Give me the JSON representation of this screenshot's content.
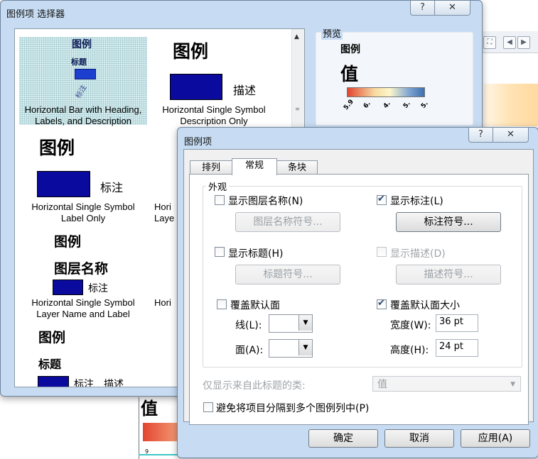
{
  "background": {
    "legend_value": "值",
    "tick": "9"
  },
  "selector": {
    "title": "图例项 选择器",
    "help": "?",
    "close": "✕",
    "items": [
      {
        "heading": "图例",
        "sub": "标题",
        "ticks": "标注",
        "caption": "Horizontal Bar with Heading, Labels, and Description"
      },
      {
        "heading": "图例",
        "desc": "描述",
        "caption": "Horizontal Single Symbol Description Only"
      },
      {
        "heading": "图例",
        "label": "标注",
        "caption": "Horizontal Single Symbol Label Only"
      },
      {
        "caption_partial": "Hori Laye"
      },
      {
        "heading": "图例",
        "layer": "图层名称",
        "label": "标注",
        "caption": "Horizontal Single Symbol Layer Name and Label"
      },
      {
        "caption_partial": "Hori"
      },
      {
        "heading": "图例",
        "sub": "标题",
        "label": "标注",
        "desc": "描述"
      }
    ],
    "preview": {
      "group_title": "预览",
      "legend_title": "图例",
      "value_title": "值",
      "ticks": [
        "5.9",
        "6.",
        "4.",
        "5.",
        "5."
      ]
    }
  },
  "dialog": {
    "title": "图例项",
    "help": "?",
    "close": "✕",
    "tabs": [
      "排列",
      "常规",
      "条块"
    ],
    "active_tab": "常规",
    "group_title": "外观",
    "show_layer_name": {
      "label": "显示图层名称(N)",
      "checked": false
    },
    "layer_symbol_btn": "图层名称符号...",
    "show_label": {
      "label": "显示标注(L)",
      "checked": true
    },
    "label_symbol_btn": "标注符号...",
    "show_heading": {
      "label": "显示标题(H)",
      "checked": false
    },
    "heading_symbol_btn": "标题符号...",
    "show_desc": {
      "label": "显示描述(D)",
      "checked": false
    },
    "desc_symbol_btn": "描述符号...",
    "override_patch": {
      "label": "覆盖默认面",
      "checked": false
    },
    "line_label": "线(L):",
    "area_label": "面(A):",
    "override_size": {
      "label": "覆盖默认面大小",
      "checked": true
    },
    "width_label": "宽度(W):",
    "width_value": "36 pt",
    "height_label": "高度(H):",
    "height_value": "24 pt",
    "only_classes_label": "仅显示来自此标题的类:",
    "only_classes_value": "值",
    "avoid_split": {
      "label": "避免将项目分隔到多个图例列中(P)",
      "checked": false
    },
    "ok": "确定",
    "cancel": "取消",
    "apply": "应用(A)"
  },
  "colors": {
    "swatch": "#0a0a9e",
    "window_frame": "#c7dcf2",
    "ramp": [
      "#e2452f",
      "#f7d9a0",
      "#fdf7c9",
      "#7fa6d1",
      "#3f6fb0"
    ]
  }
}
